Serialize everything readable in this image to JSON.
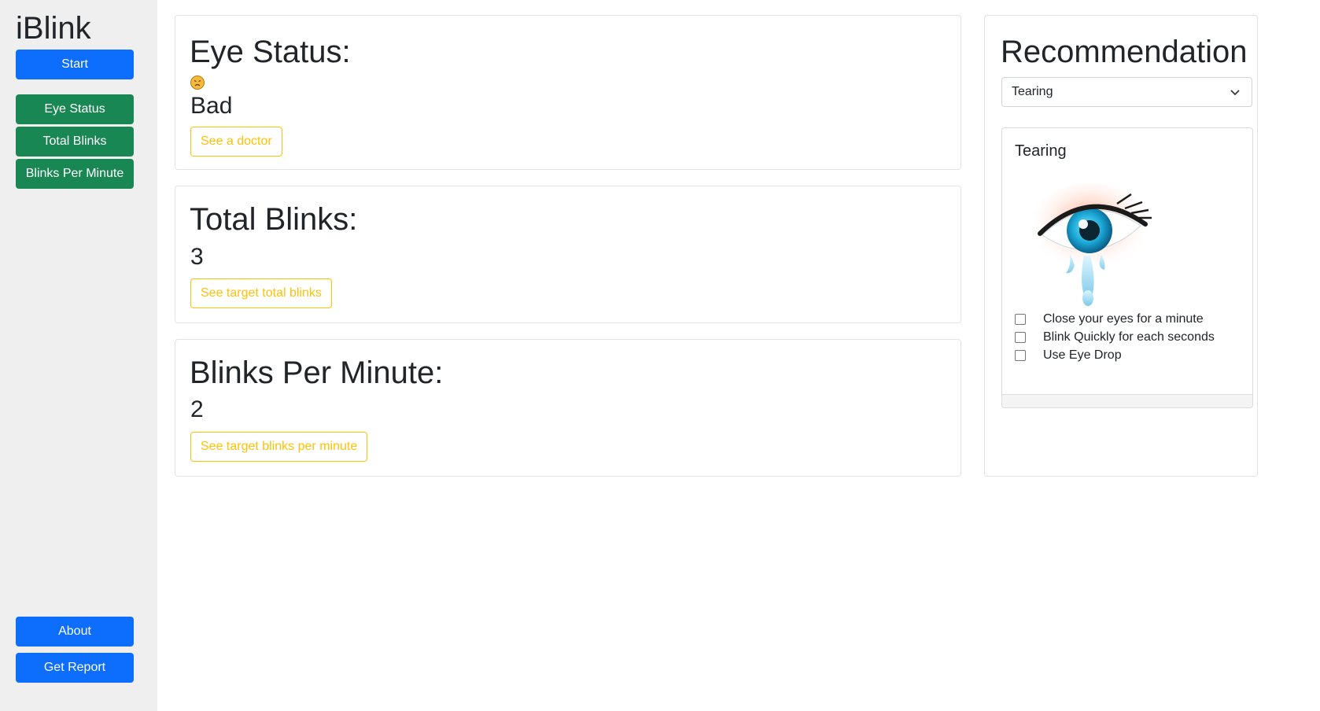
{
  "app": {
    "title": "iBlink"
  },
  "sidebar": {
    "start_label": "Start",
    "nav": [
      {
        "label": "Eye Status"
      },
      {
        "label": "Total Blinks"
      },
      {
        "label": "Blinks Per Minute"
      }
    ],
    "about_label": "About",
    "report_label": "Get Report"
  },
  "eye_status": {
    "heading": "Eye Status:",
    "icon": "sad-face-icon",
    "value": "Bad",
    "action_label": "See a doctor"
  },
  "total_blinks": {
    "heading": "Total Blinks:",
    "value": "3",
    "action_label": "See target total blinks"
  },
  "blinks_per_minute": {
    "heading": "Blinks Per Minute:",
    "value": "2",
    "action_label": "See target blinks per minute"
  },
  "recommendation": {
    "heading": "Recommendation",
    "select_value": "Tearing",
    "card_title": "Tearing",
    "image": "tearing-eye-illustration",
    "tasks": [
      {
        "label": "Close your eyes for a minute",
        "checked": false
      },
      {
        "label": "Blink Quickly for each seconds",
        "checked": false
      },
      {
        "label": "Use Eye Drop",
        "checked": false
      }
    ]
  },
  "colors": {
    "primary": "#0d6efd",
    "success": "#198754",
    "warning": "#ffc107",
    "sidebar_bg": "#efefef"
  }
}
